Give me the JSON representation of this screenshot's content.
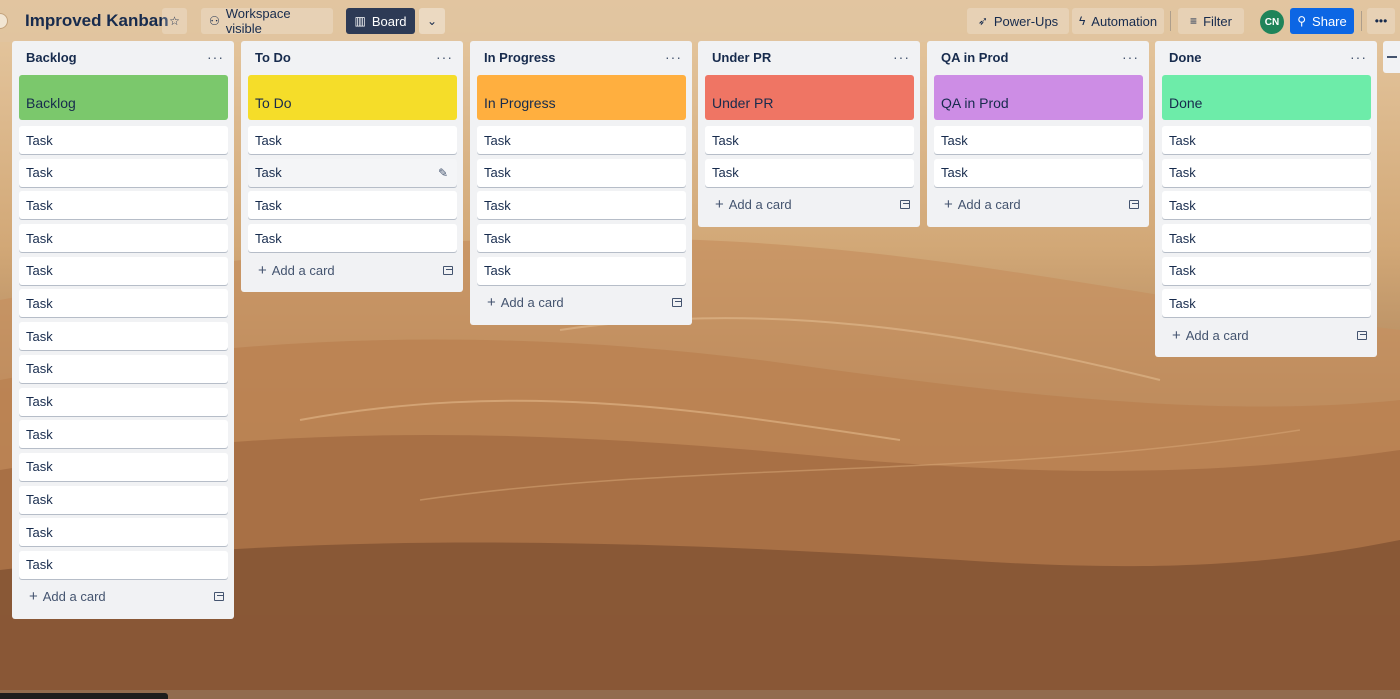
{
  "board": {
    "title": "Improved Kanban",
    "visibility_label": "Workspace visible",
    "view_label": "Board",
    "powerups_label": "Power-Ups",
    "automation_label": "Automation",
    "filter_label": "Filter",
    "avatar_initials": "CN",
    "share_label": "Share"
  },
  "add_card_label": "Add a card",
  "lists": [
    {
      "title": "Backlog",
      "cover_label": "Backlog",
      "cover_color": "#7bc86c",
      "cards": [
        "Task",
        "Task",
        "Task",
        "Task",
        "Task",
        "Task",
        "Task",
        "Task",
        "Task",
        "Task",
        "Task",
        "Task",
        "Task",
        "Task"
      ]
    },
    {
      "title": "To Do",
      "cover_label": "To Do",
      "cover_color": "#f5dd29",
      "cards": [
        "Task",
        "Task",
        "Task",
        "Task"
      ]
    },
    {
      "title": "In Progress",
      "cover_label": "In Progress",
      "cover_color": "#ffaf3f",
      "cards": [
        "Task",
        "Task",
        "Task",
        "Task",
        "Task"
      ]
    },
    {
      "title": "Under PR",
      "cover_label": "Under PR",
      "cover_color": "#ef7564",
      "cards": [
        "Task",
        "Task"
      ]
    },
    {
      "title": "QA in Prod",
      "cover_label": "QA in Prod",
      "cover_color": "#cd8de5",
      "cards": [
        "Task",
        "Task"
      ]
    },
    {
      "title": "Done",
      "cover_label": "Done",
      "cover_color": "#6deca9",
      "cards": [
        "Task",
        "Task",
        "Task",
        "Task",
        "Task",
        "Task"
      ]
    }
  ],
  "icons": {
    "star": "star-icon",
    "workspace": "people-icon",
    "board": "board-icon",
    "chevron": "chevron-down-icon",
    "powerups": "rocket-icon",
    "automation": "lightning-icon",
    "filter": "filter-icon",
    "more": "more-icon",
    "pencil": "pencil-icon",
    "template": "card-template-icon"
  }
}
